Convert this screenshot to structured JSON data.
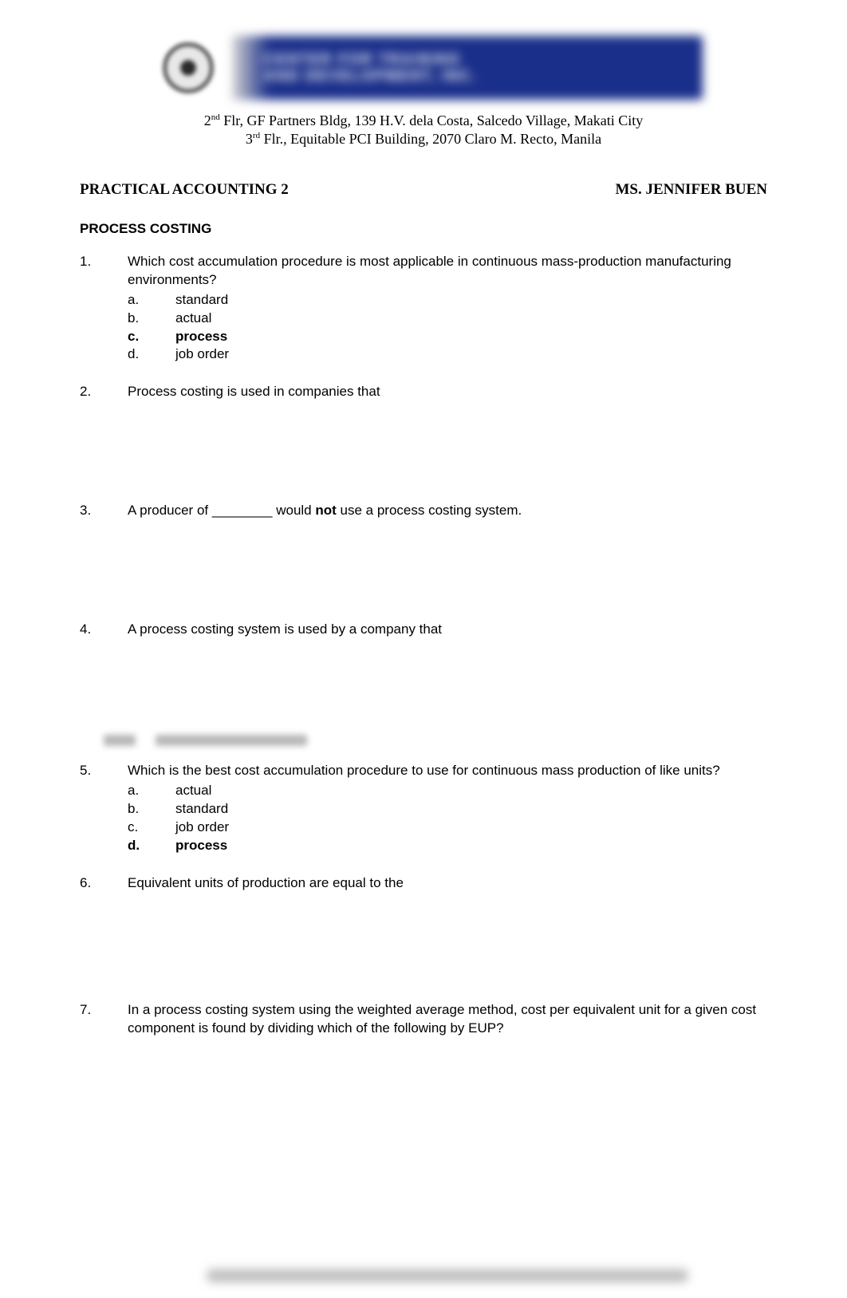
{
  "header": {
    "banner_line1": "CENTER FOR TRAINING",
    "banner_line2": "AND DEVELOPMENT, INC.",
    "address1_prefix": "2",
    "address1_ord": "nd",
    "address1_rest": " Flr, GF Partners Bldg, 139 H.V. dela Costa, Salcedo Village, Makati City",
    "address2_prefix": "3",
    "address2_ord": "rd",
    "address2_rest": " Flr., Equitable  PCI Building, 2070 Claro M. Recto, Manila"
  },
  "title_left": "PRACTICAL ACCOUNTING 2",
  "title_right": "MS. JENNIFER BUEN",
  "section": "PROCESS COSTING",
  "questions": {
    "q1": {
      "num": "1.",
      "text": "Which cost accumulation procedure is most applicable in continuous mass-production manufacturing environments?",
      "a_letter": "a.",
      "a_text": "standard",
      "b_letter": "b.",
      "b_text": "actual",
      "c_letter": "c.",
      "c_text": "process",
      "d_letter": "d.",
      "d_text": "job order"
    },
    "q2": {
      "num": "2.",
      "text": "Process costing is used in companies that"
    },
    "q3": {
      "num": "3.",
      "text_before": "A producer of ",
      "blank": "________",
      "text_after_pre": " would ",
      "text_not": "not",
      "text_after_post": " use a process costing system."
    },
    "q4": {
      "num": "4.",
      "text": "A process costing system is used by a company that"
    },
    "q5": {
      "num": "5.",
      "text": "Which is the best cost accumulation procedure to use for continuous mass production of like units?",
      "a_letter": "a.",
      "a_text": "actual",
      "b_letter": "b.",
      "b_text": "standard",
      "c_letter": "c.",
      "c_text": "job order",
      "d_letter": "d.",
      "d_text": "process"
    },
    "q6": {
      "num": "6.",
      "text": "Equivalent units of production are equal to the"
    },
    "q7": {
      "num": "7.",
      "text": "In a process costing system using the weighted average method, cost per equivalent unit for a given cost component is found by dividing which of the following by EUP?"
    }
  }
}
